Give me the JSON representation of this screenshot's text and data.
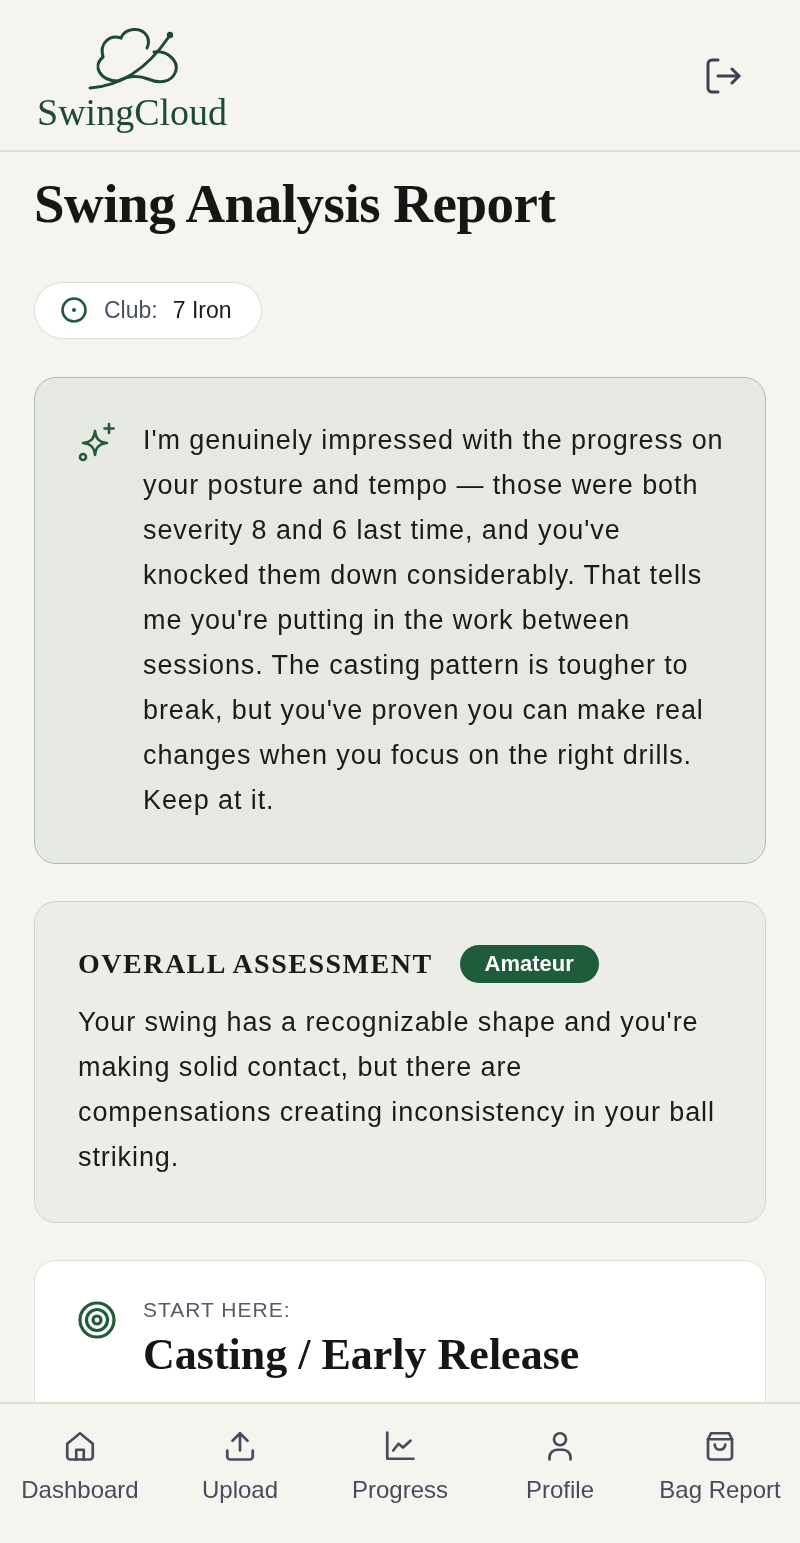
{
  "header": {
    "brand": "SwingCloud"
  },
  "title": "Swing Analysis Report",
  "club": {
    "label": "Club:",
    "value": "7 Iron"
  },
  "coach_note": {
    "text": "I'm genuinely impressed with the progress on your posture and tempo — those were both severity 8 and 6 last time, and you've knocked them down considerably. That tells me you're putting in the work between sessions. The casting pattern is tougher to break, but you've proven you can make real changes when you focus on the right drills. Keep at it."
  },
  "overall_assessment": {
    "heading": "OVERALL ASSESSMENT",
    "badge": "Amateur",
    "text": "Your swing has a recognizable shape and you're making solid contact, but there are compensations creating inconsistency in your ball striking."
  },
  "focus": {
    "label": "START HERE:",
    "title": "Casting / Early Release"
  },
  "nav": [
    {
      "kind": "home",
      "label": "Dashboard"
    },
    {
      "kind": "upload",
      "label": "Upload"
    },
    {
      "kind": "chart",
      "label": "Progress"
    },
    {
      "kind": "person",
      "label": "Profile"
    },
    {
      "kind": "bag",
      "label": "Bag Report"
    }
  ]
}
